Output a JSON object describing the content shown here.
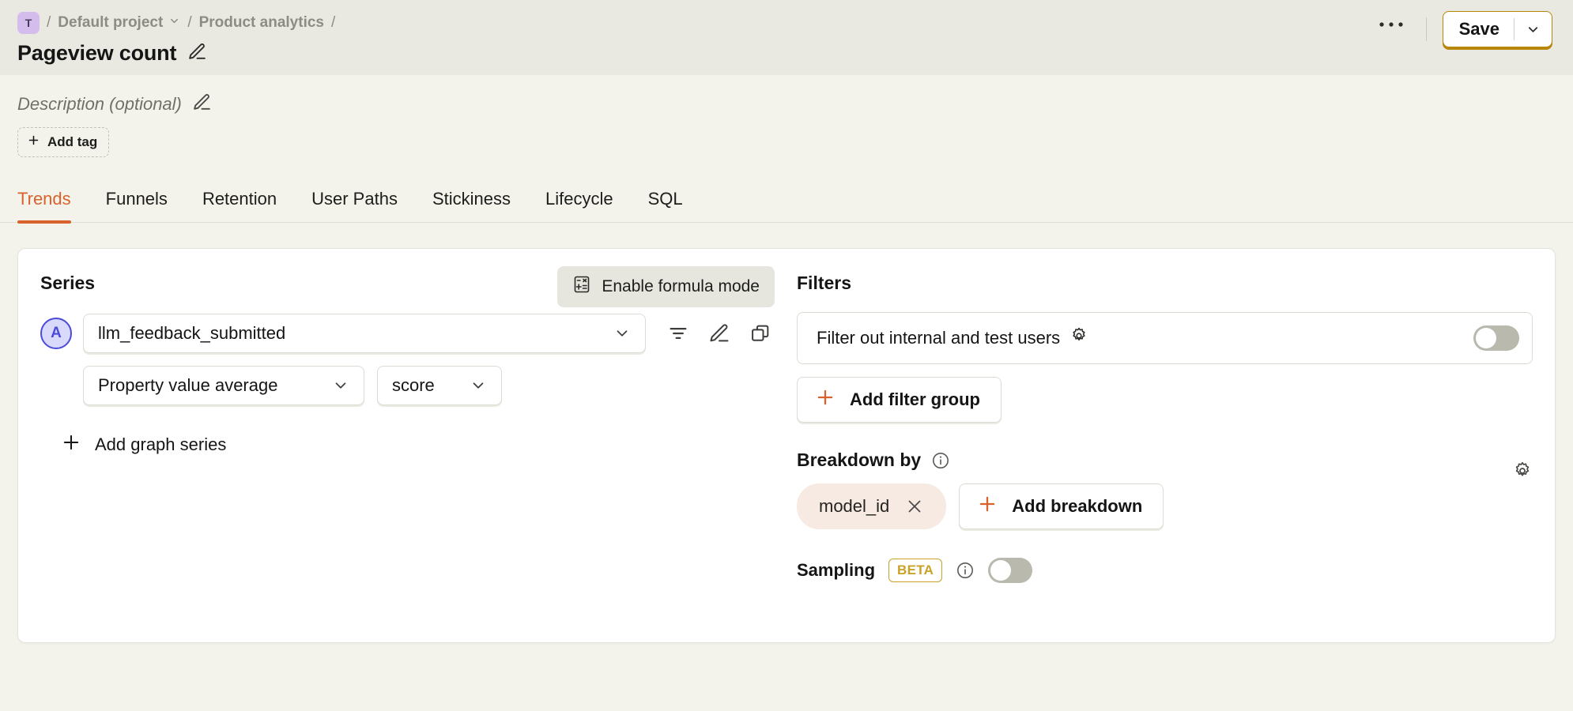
{
  "breadcrumb": {
    "project_initial": "T",
    "separator": "/",
    "project": "Default project",
    "section": "Product analytics"
  },
  "header": {
    "title": "Pageview count",
    "edit_title_icon": "pencil-icon",
    "more_options_icon": "ellipsis-icon",
    "save_label": "Save",
    "save_caret_icon": "chevron-down-icon"
  },
  "meta": {
    "description_placeholder": "Description (optional)",
    "description_edit_icon": "pencil-icon",
    "add_tag_label": "Add tag",
    "add_tag_icon": "plus-icon"
  },
  "tabs": [
    {
      "label": "Trends",
      "active": true
    },
    {
      "label": "Funnels",
      "active": false
    },
    {
      "label": "Retention",
      "active": false
    },
    {
      "label": "User Paths",
      "active": false
    },
    {
      "label": "Stickiness",
      "active": false
    },
    {
      "label": "Lifecycle",
      "active": false
    },
    {
      "label": "SQL",
      "active": false
    }
  ],
  "series_panel": {
    "heading": "Series",
    "formula_button_label": "Enable formula mode",
    "formula_button_icon": "calculator-icon",
    "series_letter": "A",
    "event_name": "llm_feedback_submitted",
    "event_caret_icon": "chevron-down-icon",
    "row_actions": [
      {
        "icon": "filter-icon"
      },
      {
        "icon": "pencil-icon"
      },
      {
        "icon": "duplicate-icon"
      }
    ],
    "math_label": "Property value average",
    "math_caret_icon": "chevron-down-icon",
    "property_label": "score",
    "property_caret_icon": "chevron-down-icon",
    "add_series_label": "Add graph series",
    "add_series_icon": "plus-icon"
  },
  "filters_panel": {
    "heading": "Filters",
    "internal_users_label": "Filter out internal and test users",
    "internal_users_gear_icon": "gear-icon",
    "internal_users_toggle": "off",
    "add_filter_group_label": "Add filter group",
    "add_filter_group_icon": "plus-icon"
  },
  "breakdown_panel": {
    "heading": "Breakdown by",
    "info_icon": "info-icon",
    "settings_icon": "gear-icon",
    "breakdowns": [
      {
        "label": "model_id",
        "remove_icon": "close-icon"
      }
    ],
    "add_breakdown_label": "Add breakdown",
    "add_breakdown_icon": "plus-icon"
  },
  "sampling_panel": {
    "label": "Sampling",
    "badge": "BETA",
    "info_icon": "info-icon",
    "toggle": "off"
  },
  "colors": {
    "accent": "#d9622b",
    "save_border": "#b8860b",
    "beta": "#c9a227",
    "series_badge": "#4b4bd8",
    "pill_bg": "#f6eae2",
    "page_bg": "#f3f3ec",
    "topbar_bg": "#e9e9e2"
  }
}
